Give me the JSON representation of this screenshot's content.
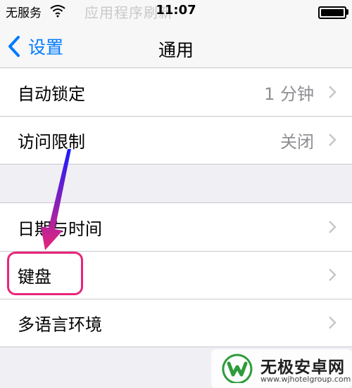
{
  "status": {
    "carrier": "无服务",
    "time": "11:07",
    "battery_level": 1.0
  },
  "background_text": "应用程序刷新",
  "nav": {
    "back_label": "设置",
    "title": "通用"
  },
  "groups": [
    {
      "rows": [
        {
          "label": "自动锁定",
          "value": "1 分钟"
        },
        {
          "label": "访问限制",
          "value": "关闭"
        }
      ]
    },
    {
      "rows": [
        {
          "label": "日期与时间"
        },
        {
          "label": "键盘"
        },
        {
          "label": "多语言环境"
        }
      ]
    }
  ],
  "annotation": {
    "highlight_color": "#e8257a",
    "arrow_color": "#1a1aff"
  },
  "watermark": {
    "title": "无极安卓网",
    "url": "www.wjhotelgroup.com"
  },
  "colors": {
    "accent": "#007aff",
    "secondary_text": "#8e8e93",
    "separator": "#c8c7cc",
    "background": "#efeff4"
  }
}
